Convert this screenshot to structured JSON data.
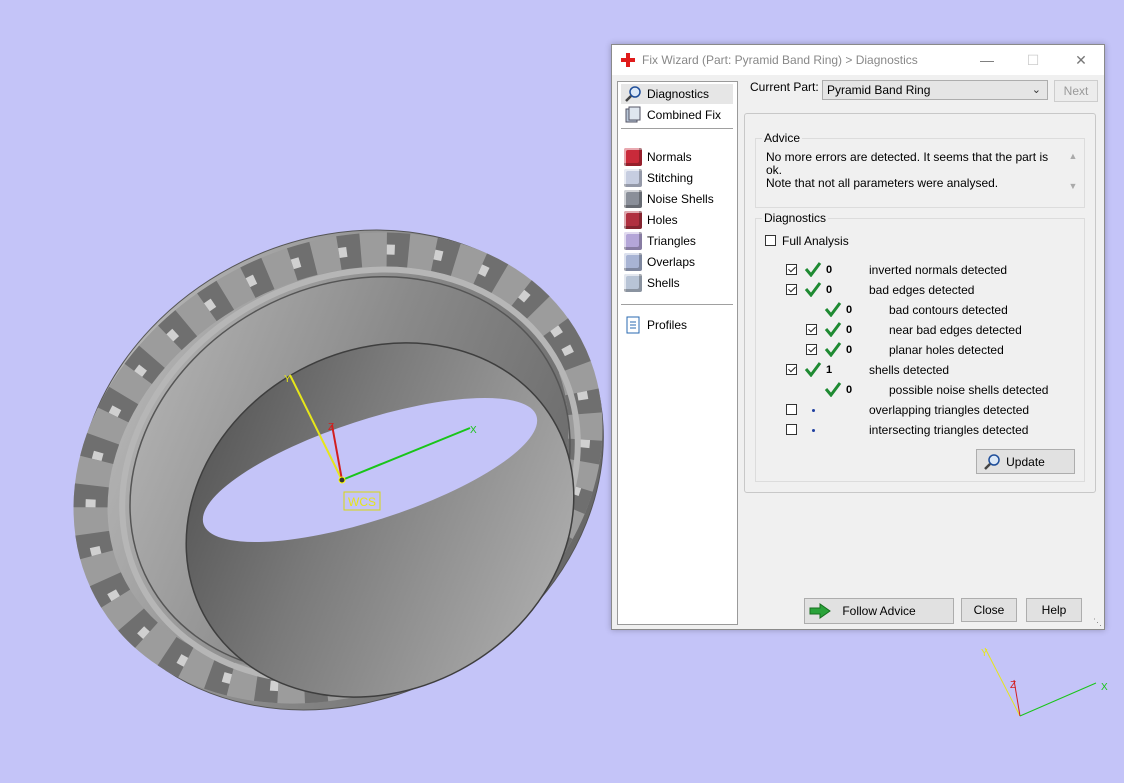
{
  "window": {
    "title": "Fix Wizard (Part: Pyramid Band Ring) > Diagnostics",
    "min_label": "—",
    "max_label": "☐",
    "close_label": "✕"
  },
  "viewport": {
    "wcs_label": "WCS",
    "axes": {
      "x": "X",
      "y": "Y",
      "z": "Z"
    }
  },
  "nav": {
    "diagnostics": "Diagnostics",
    "combined_fix": "Combined Fix",
    "normals": "Normals",
    "stitching": "Stitching",
    "noise_shells": "Noise Shells",
    "holes": "Holes",
    "triangles": "Triangles",
    "overlaps": "Overlaps",
    "shells": "Shells",
    "profiles": "Profiles"
  },
  "current_part": {
    "label": "Current Part:",
    "value": "Pyramid Band Ring",
    "next_label": "Next"
  },
  "advice": {
    "title": "Advice",
    "line1": "No more errors are detected. It seems that the part is ok.",
    "line2": "Note that not all parameters were analysed."
  },
  "diagnostics": {
    "title": "Diagnostics",
    "full_analysis_label": "Full Analysis",
    "rows": [
      {
        "count": "0",
        "desc": "inverted normals detected",
        "checked": true
      },
      {
        "count": "0",
        "desc": "bad edges detected",
        "checked": true
      },
      {
        "count": "0",
        "desc": "bad contours detected"
      },
      {
        "count": "0",
        "desc": "near bad edges detected",
        "checked": true
      },
      {
        "count": "0",
        "desc": "planar holes detected",
        "checked": true
      },
      {
        "count": "1",
        "desc": "shells detected",
        "checked": true
      },
      {
        "count": "0",
        "desc": "possible noise shells detected"
      },
      {
        "count": "",
        "desc": "overlapping triangles detected",
        "checked": false
      },
      {
        "count": "",
        "desc": "intersecting triangles detected",
        "checked": false
      }
    ],
    "update_label": "Update"
  },
  "footer": {
    "follow_advice_label": "Follow Advice",
    "close_label": "Close",
    "help_label": "Help"
  },
  "colors": {
    "background": "#c4c4f8",
    "ring": "#8e8e8e",
    "check_green": "#1e8a32",
    "axis_x": "#19c519",
    "axis_y": "#e6e61a",
    "axis_z": "#d21e1e"
  }
}
